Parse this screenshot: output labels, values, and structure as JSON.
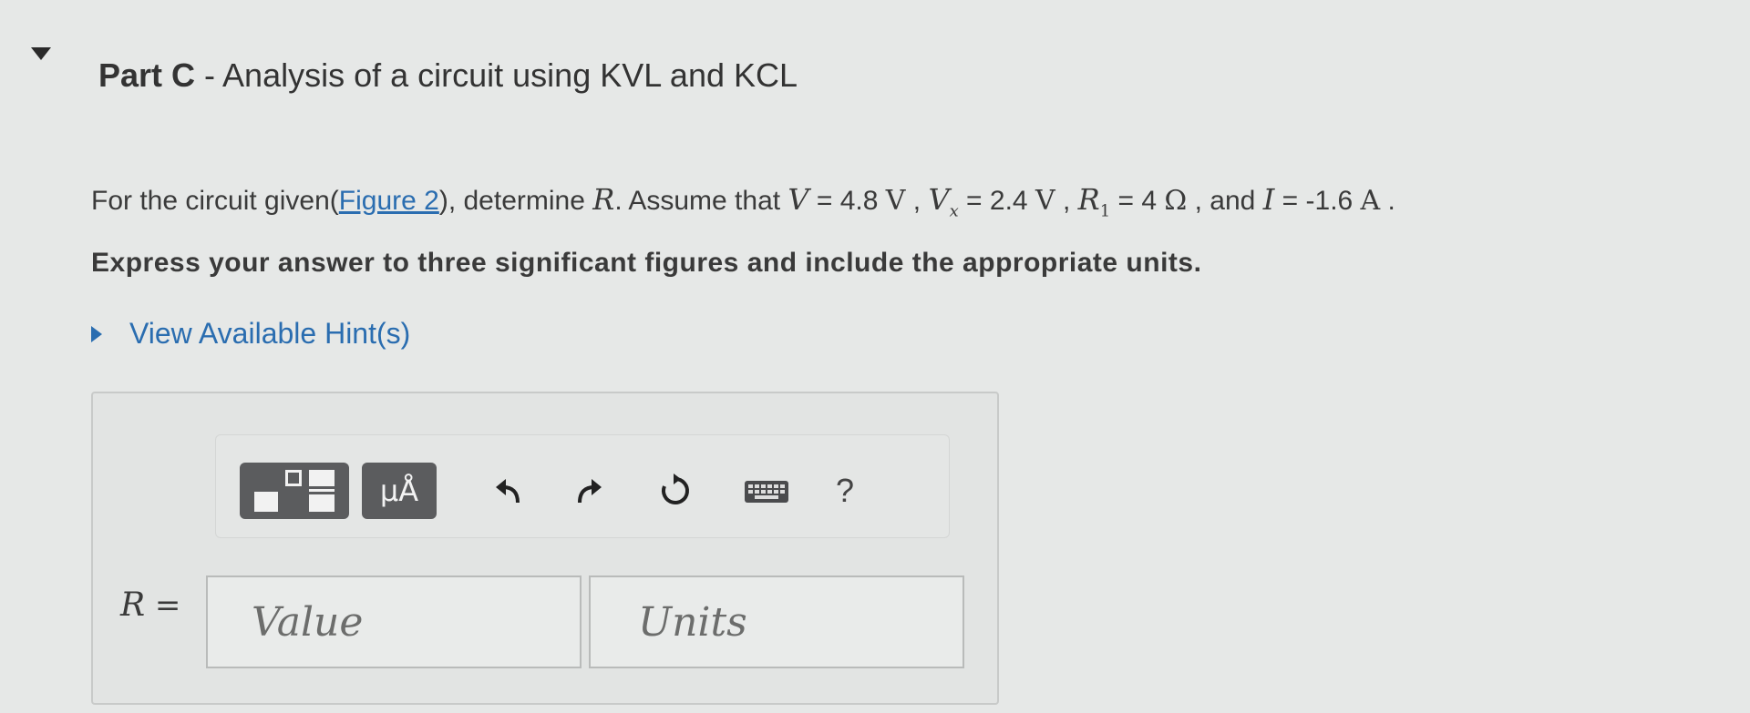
{
  "part": {
    "label": "Part C",
    "separator": " - ",
    "title": "Analysis of a circuit using KVL and KCL"
  },
  "problem": {
    "intro": "For the circuit given(",
    "figure_link": "Figure 2",
    "after_link": "), determine ",
    "unknown_var": "R",
    "assume": ". Assume that ",
    "v_sym": "V",
    "eq1": " = 4.8 ",
    "v_unit": "V",
    "sep1": " , ",
    "vx_sym": "V",
    "vx_sub": "x",
    "eq2": " = 2.4 ",
    "vx_unit": "V",
    "sep2": " , ",
    "r1_sym": "R",
    "r1_sub": "1",
    "eq3": " = 4 ",
    "r1_unit": "Ω",
    "sep3": " , and ",
    "i_sym": "I",
    "eq4": " = -1.6 ",
    "i_unit": "A",
    "end": " ."
  },
  "instruction": "Express your answer to three significant figures and include the appropriate units.",
  "hint": {
    "label": "View Available Hint(s)"
  },
  "toolbar": {
    "units_button_label": "μÅ",
    "help_label": "?"
  },
  "answer": {
    "variable": "R",
    "equals": " =",
    "value_placeholder": "Value",
    "units_placeholder": "Units"
  }
}
